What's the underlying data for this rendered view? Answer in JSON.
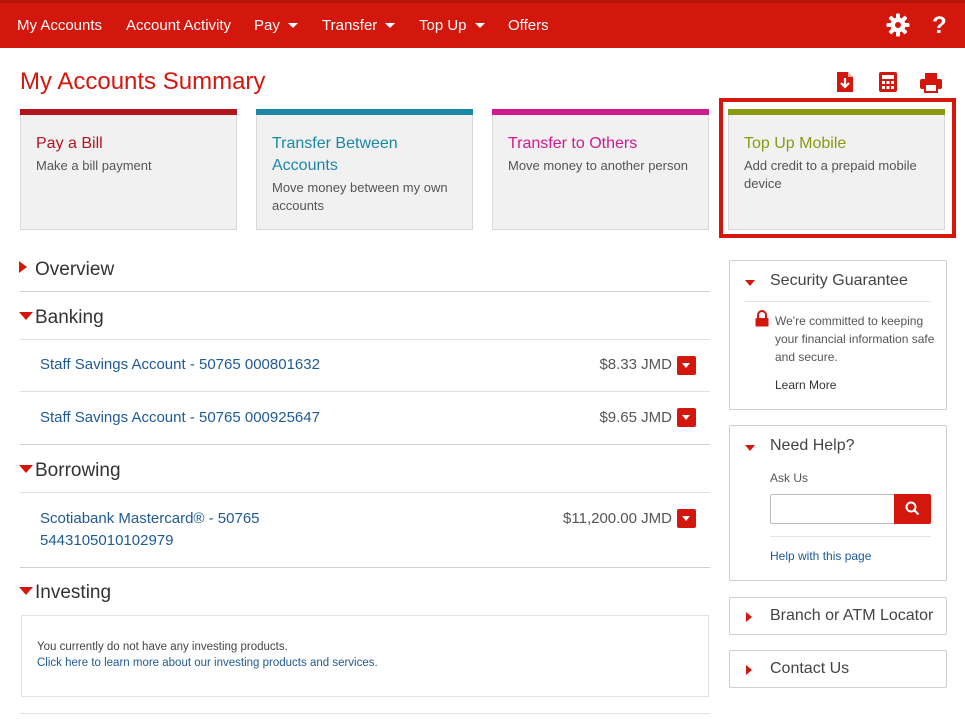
{
  "nav": {
    "items": [
      {
        "label": "My Accounts",
        "dropdown": false
      },
      {
        "label": "Account Activity",
        "dropdown": false
      },
      {
        "label": "Pay",
        "dropdown": true
      },
      {
        "label": "Transfer",
        "dropdown": true
      },
      {
        "label": "Top Up",
        "dropdown": true
      },
      {
        "label": "Offers",
        "dropdown": false
      }
    ],
    "settings_icon": "gear-icon",
    "help_icon": "?"
  },
  "page": {
    "title": "My Accounts Summary",
    "tools": [
      "download-icon",
      "calculator-icon",
      "print-icon"
    ]
  },
  "tiles": [
    {
      "title": "Pay a Bill",
      "desc": "Make a bill payment",
      "color": "#b5141f",
      "selected": false
    },
    {
      "title": "Transfer Between Accounts",
      "desc": "Move money between my own accounts",
      "color": "#1a88a6",
      "selected": false
    },
    {
      "title": "Transfer to Others",
      "desc": "Move money to another person",
      "color": "#d11a8d",
      "selected": false
    },
    {
      "title": "Top Up Mobile",
      "desc": "Add credit to a prepaid mobile device",
      "color": "#8a9a12",
      "selected": true
    }
  ],
  "sections": {
    "overview": {
      "label": "Overview"
    },
    "banking": {
      "label": "Banking",
      "accounts": [
        {
          "name": "Staff Savings Account - 50765 000801632",
          "balance": "$8.33 JMD"
        },
        {
          "name": "Staff Savings Account - 50765 000925647",
          "balance": "$9.65 JMD"
        }
      ]
    },
    "borrowing": {
      "label": "Borrowing",
      "accounts": [
        {
          "name_line1": "Scotiabank Mastercard® - 50765",
          "name_line2": "5443105010102979",
          "balance": "$11,200.00 JMD"
        }
      ]
    },
    "investing": {
      "label": "Investing",
      "message": "You currently do not have any investing products.",
      "link": "Click here to learn more about our investing products and services."
    }
  },
  "sidebar": {
    "security": {
      "title": "Security Guarantee",
      "text_lines": [
        "We're committed to keeping",
        "your financial information safe",
        "and secure."
      ],
      "link": "Learn More"
    },
    "help": {
      "title": "Need Help?",
      "ask_label": "Ask Us",
      "search_value": "",
      "link": "Help with this page"
    },
    "locator": {
      "title": "Branch or ATM Locator"
    },
    "contact": {
      "title": "Contact Us"
    }
  },
  "colors": {
    "brand": "#d4170d",
    "link": "#1f5a96"
  }
}
